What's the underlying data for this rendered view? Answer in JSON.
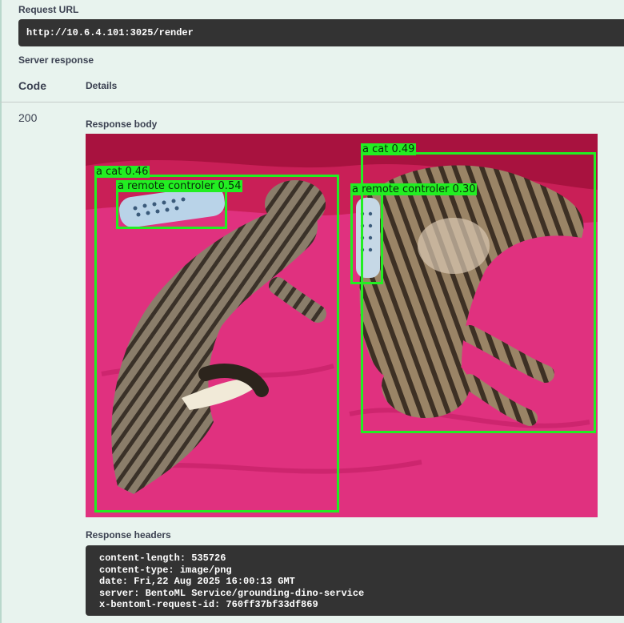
{
  "request": {
    "label": "Request URL",
    "url": "http://10.6.4.101:3025/render"
  },
  "server_response": {
    "label": "Server response",
    "columns": {
      "code": "Code",
      "details": "Details"
    },
    "status_code": "200",
    "response_body_label": "Response body",
    "detections": [
      {
        "label": "a cat 0.46"
      },
      {
        "label": "a remote controler 0.54"
      },
      {
        "label": "a cat 0.49"
      },
      {
        "label": "a remote controler 0.30"
      }
    ],
    "response_headers_label": "Response headers",
    "headers": [
      "content-length: 535726",
      "content-type: image/png",
      "date: Fri,22 Aug 2025 16:00:13 GMT",
      "server: BentoML Service/grounding-dino-service",
      "x-bentoml-request-id: 760ff37bf33df869"
    ]
  },
  "colors": {
    "box": "#22ee22",
    "code_bg": "#333333",
    "page_bg": "#e8f3ee"
  }
}
